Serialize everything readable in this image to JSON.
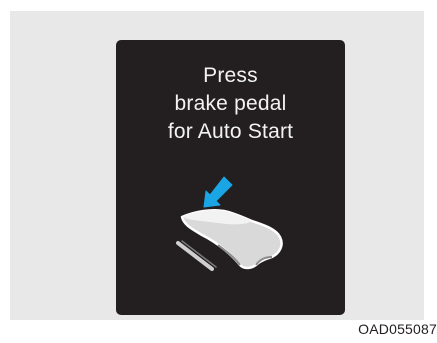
{
  "message": {
    "line1": "Press",
    "line2": "brake pedal",
    "line3": "for Auto Start"
  },
  "graphic": {
    "icon": "foot-press-brake-pedal-icon",
    "arrow_color": "#1aa6e4"
  },
  "colors": {
    "display_background": "#231f20",
    "panel_background": "#e8e8e8",
    "text": "#f2f2f2"
  },
  "caption": {
    "code": "OAD055087"
  }
}
